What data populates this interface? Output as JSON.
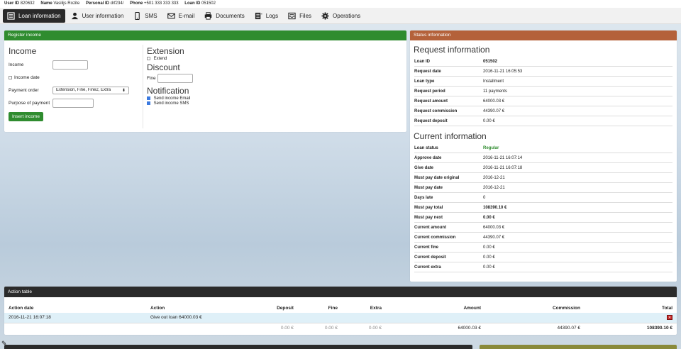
{
  "top_info": {
    "user_id_label": "User ID",
    "user_id": "820632",
    "name_label": "Name",
    "name": "Vasilijs Rozite",
    "personal_id_label": "Personal ID",
    "personal_id": "drf234/",
    "phone_label": "Phone",
    "phone": "+501 333 333 333",
    "loan_id_label": "Loan ID",
    "loan_id": "051502"
  },
  "nav": [
    {
      "label": "Loan information",
      "icon": "document-icon",
      "active": true
    },
    {
      "label": "User information",
      "icon": "user-icon"
    },
    {
      "label": "SMS",
      "icon": "phone-icon"
    },
    {
      "label": "E-mail",
      "icon": "envelope-icon"
    },
    {
      "label": "Documents",
      "icon": "printer-icon"
    },
    {
      "label": "Logs",
      "icon": "list-icon"
    },
    {
      "label": "Files",
      "icon": "inbox-icon"
    },
    {
      "label": "Operations",
      "icon": "gear-icon"
    }
  ],
  "register": {
    "header": "Register income",
    "income_title": "Income",
    "income_label": "Income",
    "income_date_label": "Income date",
    "payment_order_label": "Payment order",
    "payment_order_value": "Extension, Fine, Fine2, Extra",
    "purpose_label": "Purpose of payment",
    "submit": "Insert income",
    "extension_title": "Extension",
    "extend_label": "Extend",
    "discount_title": "Discount",
    "fine_label": "Fine",
    "notification_title": "Notification",
    "send_email_label": "Send income Email",
    "send_sms_label": "Send income SMS"
  },
  "status": {
    "header": "Status information",
    "request_title": "Request information",
    "request_rows": [
      {
        "k": "Loan ID",
        "v": "051502",
        "bold": true
      },
      {
        "k": "Request date",
        "v": "2016-11-21 16:05:53"
      },
      {
        "k": "Loan type",
        "v": "Installment"
      },
      {
        "k": "Request period",
        "v": "11 payments"
      },
      {
        "k": "Request amount",
        "v": "64000.03 €"
      },
      {
        "k": "Request commission",
        "v": "44390.07 €"
      },
      {
        "k": "Request deposit",
        "v": "0.00 €"
      }
    ],
    "current_title": "Current information",
    "current_rows": [
      {
        "k": "Loan status",
        "v": "Regular",
        "green": true
      },
      {
        "k": "Approve date",
        "v": "2016-11-21 16:07:14"
      },
      {
        "k": "Give date",
        "v": "2016-11-21 16:07:18"
      },
      {
        "k": "Must pay date original",
        "v": "2016-12-21"
      },
      {
        "k": "Must pay date",
        "v": "2016-12-21"
      },
      {
        "k": "Days late",
        "v": "0"
      },
      {
        "k": "Must pay total",
        "v": "108390.10 €",
        "bold": true
      },
      {
        "k": "Must pay next",
        "v": "0.00 €",
        "bold": true
      },
      {
        "k": "Current amount",
        "v": "64000.03 €"
      },
      {
        "k": "Current commission",
        "v": "44390.07 €"
      },
      {
        "k": "Current fine",
        "v": "0.00 €"
      },
      {
        "k": "Current deposit",
        "v": "0.00 €"
      },
      {
        "k": "Current extra",
        "v": "0.00 €"
      }
    ]
  },
  "action_table": {
    "header": "Action table",
    "columns": [
      "Action date",
      "Action",
      "Deposit",
      "Fine",
      "Extra",
      "Amount",
      "Commission",
      "Total"
    ],
    "row": {
      "date": "2016-11-21 16:07:18",
      "action": "Give out loan 64000.03 €"
    },
    "totals": {
      "deposit": "0.00 €",
      "fine": "0.00 €",
      "extra": "0.00 €",
      "amount": "64000.03 €",
      "commission": "44390.07 €",
      "total": "108390.10 €"
    }
  },
  "colors": {
    "green": "#2f8c2f",
    "brown": "#b4613a",
    "dark": "#2b2b2b"
  }
}
